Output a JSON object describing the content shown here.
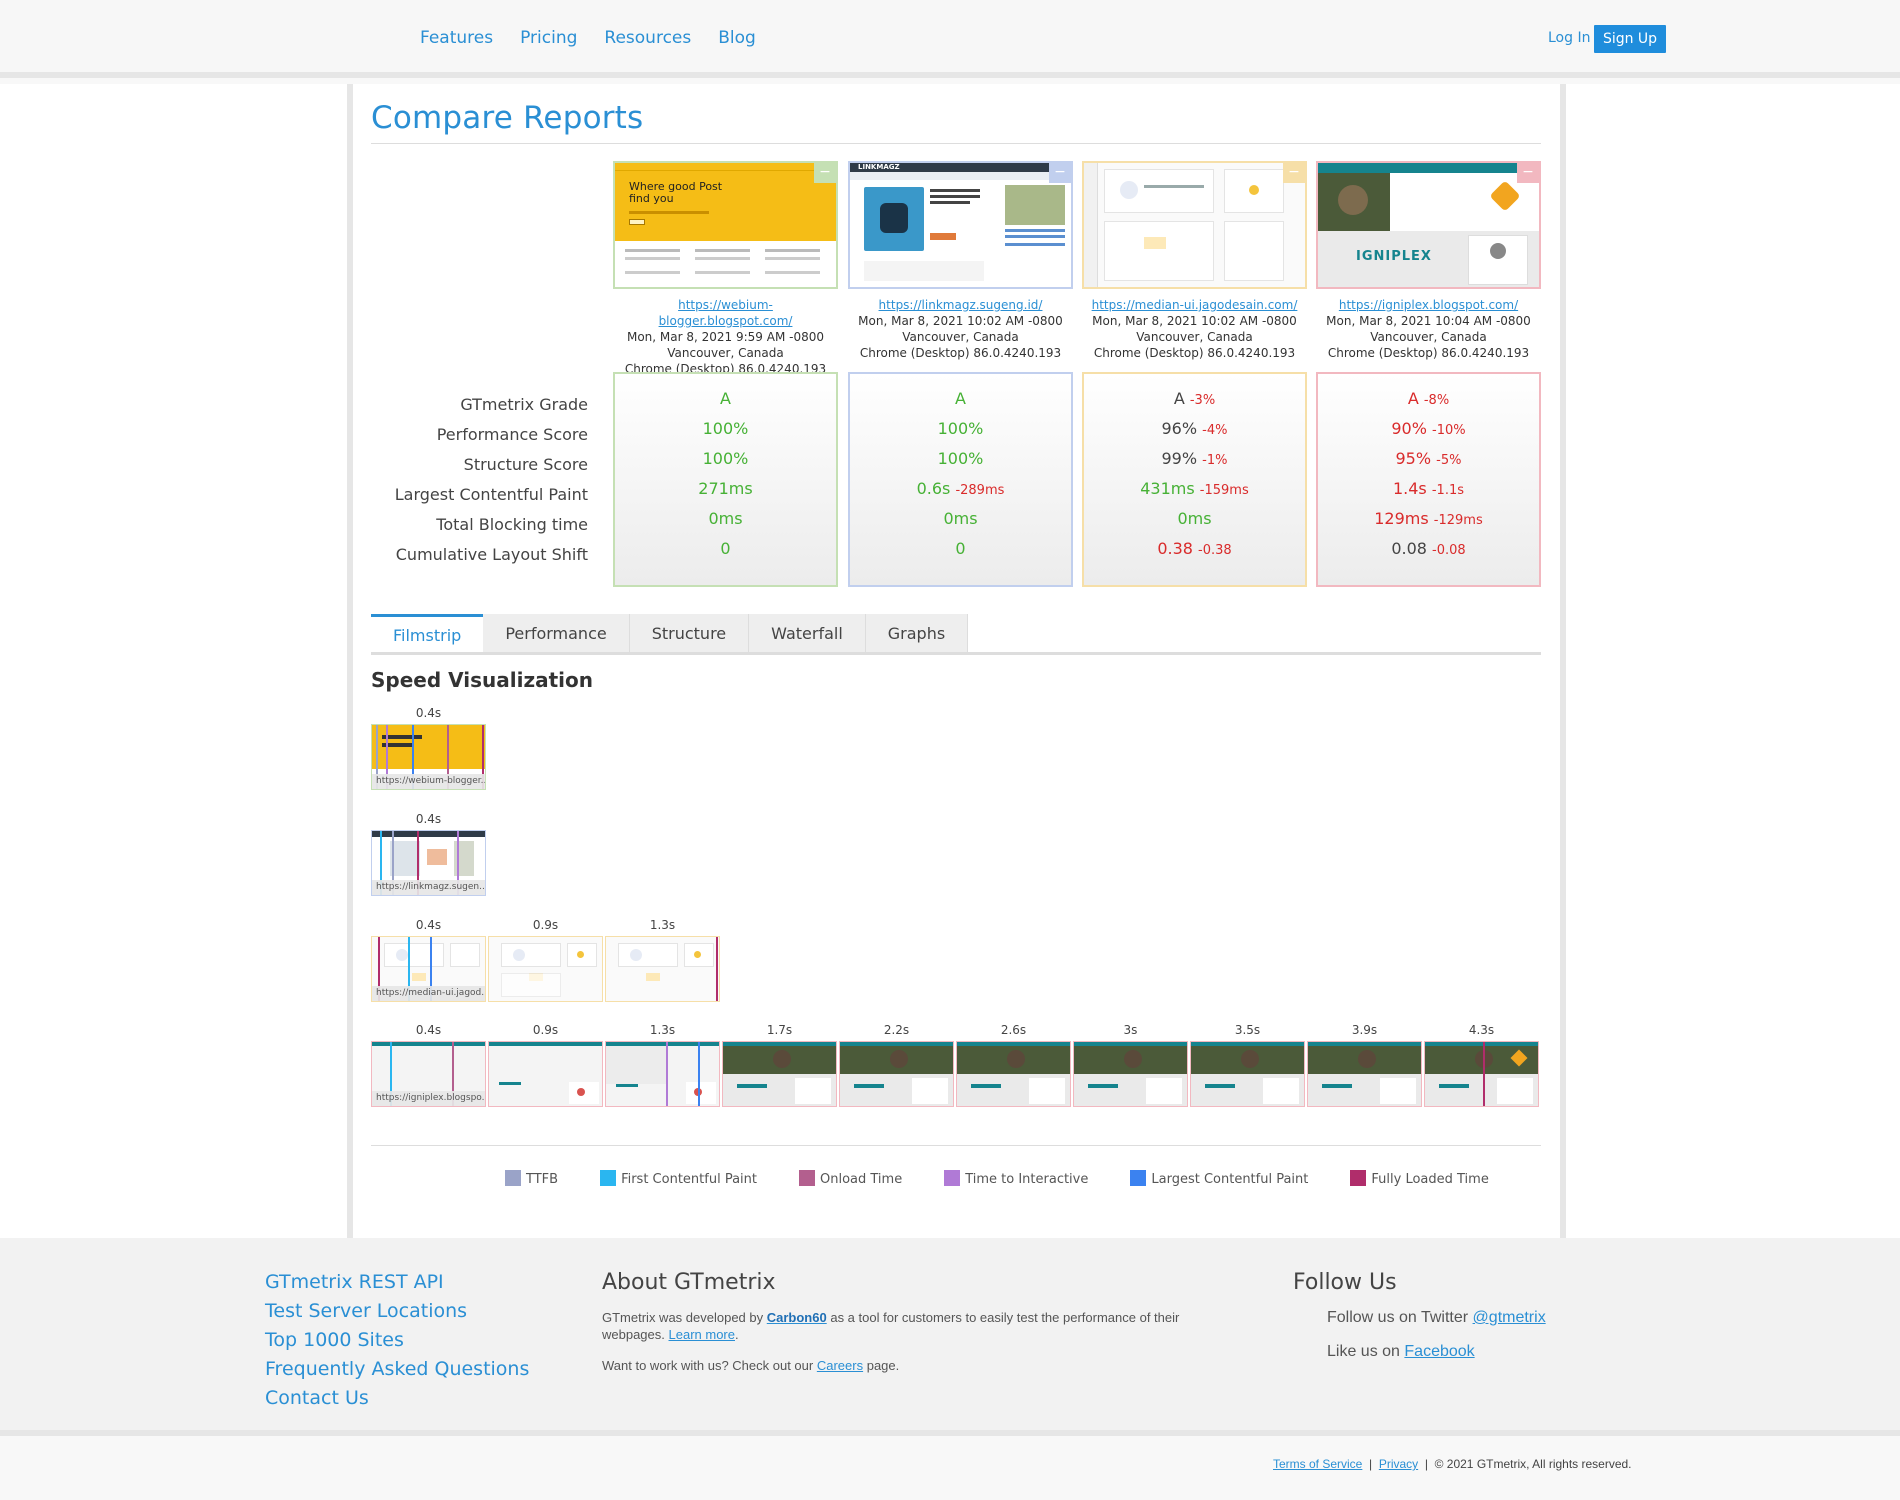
{
  "nav": {
    "items": [
      "Features",
      "Pricing",
      "Resources",
      "Blog"
    ],
    "login": "Log In",
    "signup": "Sign Up"
  },
  "page": {
    "title": "Compare Reports"
  },
  "metric_labels": [
    "GTmetrix Grade",
    "Performance Score",
    "Structure Score",
    "Largest Contentful Paint",
    "Total Blocking time",
    "Cumulative Layout Shift"
  ],
  "reports": [
    {
      "url": "https://webium-blogger.blogspot.com/",
      "date": "Mon, Mar 8, 2021 9:59 AM -0800",
      "location": "Vancouver, Canada",
      "browser": "Chrome (Desktop) 86.0.4240.193",
      "color": "#c5e0b4",
      "thumb_text": "Where good Post find you",
      "grade": "A",
      "grade_delta": "",
      "performance": "100%",
      "performance_delta": "",
      "structure": "100%",
      "structure_delta": "",
      "lcp": "271ms",
      "lcp_delta": "",
      "tbt": "0ms",
      "tbt_delta": "",
      "cls": "0",
      "cls_delta": ""
    },
    {
      "url": "https://linkmagz.sugeng.id/",
      "date": "Mon, Mar 8, 2021 10:02 AM -0800",
      "location": "Vancouver, Canada",
      "browser": "Chrome (Desktop) 86.0.4240.193",
      "color": "#c1cfee",
      "thumb_text": "LINKMAGZ",
      "grade": "A",
      "grade_delta": "",
      "performance": "100%",
      "performance_delta": "",
      "structure": "100%",
      "structure_delta": "",
      "lcp": "0.6s",
      "lcp_delta": "-289ms",
      "tbt": "0ms",
      "tbt_delta": "",
      "cls": "0",
      "cls_delta": ""
    },
    {
      "url": "https://median-ui.jagodesain.com/",
      "date": "Mon, Mar 8, 2021 10:02 AM -0800",
      "location": "Vancouver, Canada",
      "browser": "Chrome (Desktop) 86.0.4240.193",
      "color": "#f6dfa8",
      "thumb_text": "",
      "grade": "A",
      "grade_delta": "-3%",
      "performance": "96%",
      "performance_delta": "-4%",
      "structure": "99%",
      "structure_delta": "-1%",
      "lcp": "431ms",
      "lcp_delta": "-159ms",
      "tbt": "0ms",
      "tbt_delta": "",
      "cls": "0.38",
      "cls_delta": "-0.38"
    },
    {
      "url": "https://igniplex.blogspot.com/",
      "date": "Mon, Mar 8, 2021 10:04 AM -0800",
      "location": "Vancouver, Canada",
      "browser": "Chrome (Desktop) 86.0.4240.193",
      "color": "#f2b8c0",
      "thumb_text": "IGNIPLEX",
      "grade": "A",
      "grade_delta": "-8%",
      "performance": "90%",
      "performance_delta": "-10%",
      "structure": "95%",
      "structure_delta": "-5%",
      "lcp": "1.4s",
      "lcp_delta": "-1.1s",
      "tbt": "129ms",
      "tbt_delta": "-129ms",
      "cls": "0.08",
      "cls_delta": "-0.08"
    }
  ],
  "tabs": [
    "Filmstrip",
    "Performance",
    "Structure",
    "Waterfall",
    "Graphs"
  ],
  "filmstrip": {
    "title": "Speed Visualization",
    "rows": [
      {
        "caption": "https://webium-blogger....",
        "times": [
          "0.4s"
        ]
      },
      {
        "caption": "https://linkmagz.sugen...",
        "times": [
          "0.4s"
        ]
      },
      {
        "caption": "https://median-ui.jagod...",
        "times": [
          "0.4s",
          "0.9s",
          "1.3s"
        ]
      },
      {
        "caption": "https://igniplex.blogspo...",
        "times": [
          "0.4s",
          "0.9s",
          "1.3s",
          "1.7s",
          "2.2s",
          "2.6s",
          "3s",
          "3.5s",
          "3.9s",
          "4.3s"
        ]
      }
    ]
  },
  "legend": [
    {
      "label": "TTFB",
      "color": "#9aa3c8"
    },
    {
      "label": "First Contentful Paint",
      "color": "#2ab6f0"
    },
    {
      "label": "Onload Time",
      "color": "#b35f8e"
    },
    {
      "label": "Time to Interactive",
      "color": "#b07ad6"
    },
    {
      "label": "Largest Contentful Paint",
      "color": "#3b82f0"
    },
    {
      "label": "Fully Loaded Time",
      "color": "#b02d6b"
    }
  ],
  "footer": {
    "links": [
      "GTmetrix REST API",
      "Test Server Locations",
      "Top 1000 Sites",
      "Frequently Asked Questions",
      "Contact Us"
    ],
    "about_title": "About GTmetrix",
    "about_p1_a": "GTmetrix was developed by",
    "about_p1_link": "Carbon60",
    "about_p1_b": "as a tool for customers to easily test the performance of their webpages.",
    "about_p1_more": "Learn more",
    "about_p2_a": "Want to work with us? Check out our",
    "about_p2_link": "Careers",
    "about_p2_b": "page.",
    "follow_title": "Follow Us",
    "twitter_text": "Follow us on Twitter",
    "twitter_handle": "@gtmetrix",
    "facebook_text": "Like us on",
    "facebook_link": "Facebook",
    "terms": "Terms of Service",
    "privacy": "Privacy",
    "copyright": "© 2021 GTmetrix, All rights reserved."
  }
}
